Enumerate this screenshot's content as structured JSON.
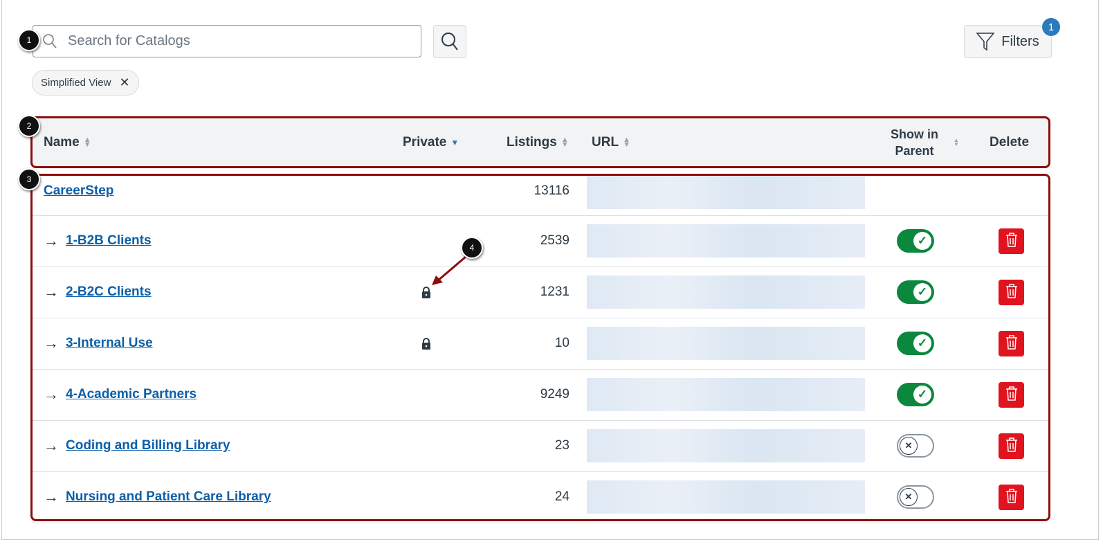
{
  "search": {
    "placeholder": "Search for Catalogs"
  },
  "filters": {
    "label": "Filters",
    "count": "1"
  },
  "chip": {
    "label": "Simplified View"
  },
  "callouts": [
    "1",
    "2",
    "3",
    "4"
  ],
  "table": {
    "headers": {
      "name": "Name",
      "private": "Private",
      "listings": "Listings",
      "url": "URL",
      "show_line1": "Show in",
      "show_line2": "Parent",
      "delete": "Delete"
    },
    "rows": [
      {
        "name": "CareerStep",
        "child": false,
        "private": false,
        "listings": "13116",
        "show": null
      },
      {
        "name": "1-B2B Clients",
        "child": true,
        "private": false,
        "listings": "2539",
        "show": true
      },
      {
        "name": "2-B2C Clients",
        "child": true,
        "private": true,
        "listings": "1231",
        "show": true
      },
      {
        "name": "3-Internal Use",
        "child": true,
        "private": true,
        "listings": "10",
        "show": true
      },
      {
        "name": "4-Academic Partners",
        "child": true,
        "private": false,
        "listings": "9249",
        "show": true
      },
      {
        "name": "Coding and Billing Library",
        "child": true,
        "private": false,
        "listings": "23",
        "show": false
      },
      {
        "name": "Nursing and Patient Care Library",
        "child": true,
        "private": false,
        "listings": "24",
        "show": false
      }
    ]
  },
  "colors": {
    "link": "#0c5fa8",
    "toggle_on": "#0b873e",
    "delete": "#e0141e",
    "highlight": "#8b0d0d",
    "badge": "#2b7abc"
  }
}
